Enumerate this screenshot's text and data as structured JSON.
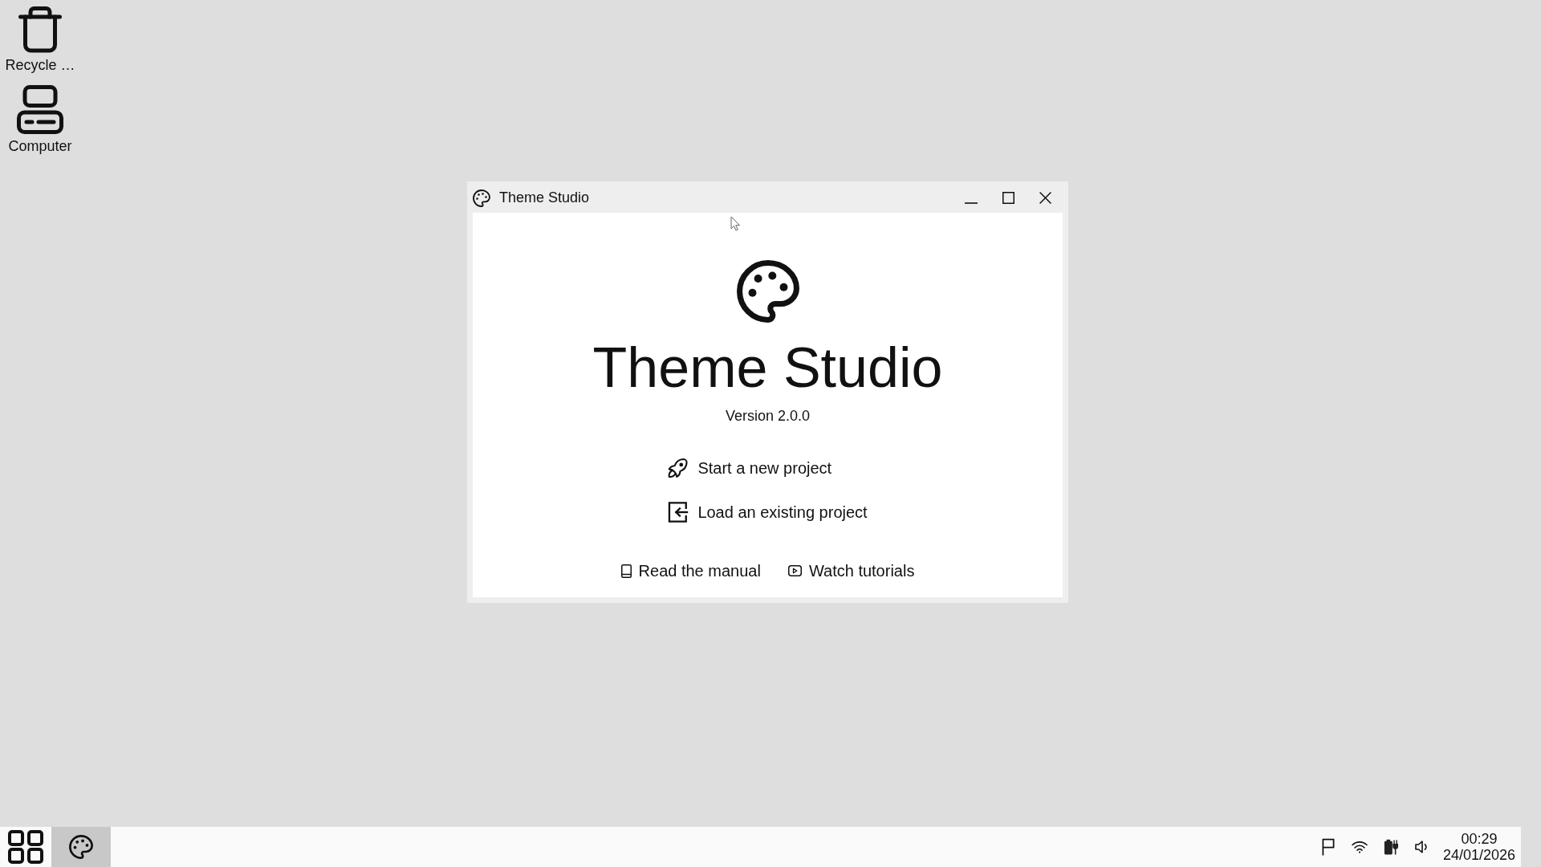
{
  "desktop_icons": [
    {
      "label": "Recycle …",
      "kind": "trash"
    },
    {
      "label": "Computer",
      "kind": "computer"
    }
  ],
  "window": {
    "title": "Theme Studio",
    "content": {
      "heading": "Theme Studio",
      "version": "Version 2.0.0",
      "actions": [
        {
          "label": "Start a new project",
          "kind": "rocket"
        },
        {
          "label": "Load an existing project",
          "kind": "import"
        }
      ],
      "links": [
        {
          "label": "Read the manual",
          "kind": "book"
        },
        {
          "label": "Watch tutorials",
          "kind": "video"
        }
      ]
    }
  },
  "taskbar": {
    "apps": [
      {
        "selected": true
      }
    ],
    "clock": {
      "time": "00:29",
      "date": "24/01/2026"
    }
  }
}
